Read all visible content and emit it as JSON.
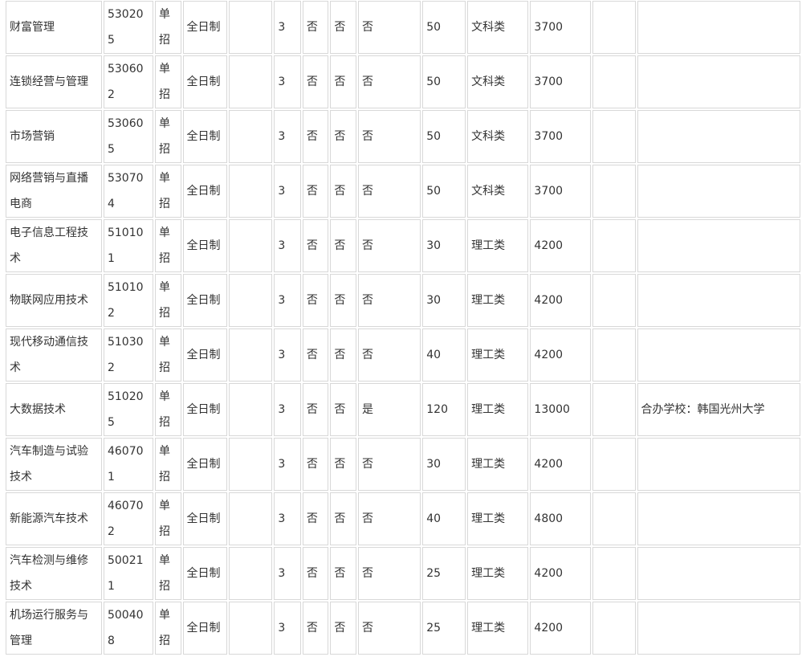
{
  "table": {
    "rows": [
      {
        "major": "财富管理",
        "code": "530205",
        "type": "单招",
        "mode": "全日制",
        "blank1": "",
        "years": "3",
        "f1": "否",
        "f2": "否",
        "f3": "否",
        "plan": "50",
        "category": "文科类",
        "fee": "3700",
        "blank2": "",
        "note": ""
      },
      {
        "major": "连锁经营与管理",
        "code": "530602",
        "type": "单招",
        "mode": "全日制",
        "blank1": "",
        "years": "3",
        "f1": "否",
        "f2": "否",
        "f3": "否",
        "plan": "50",
        "category": "文科类",
        "fee": "3700",
        "blank2": "",
        "note": ""
      },
      {
        "major": "市场营销",
        "code": "530605",
        "type": "单招",
        "mode": "全日制",
        "blank1": "",
        "years": "3",
        "f1": "否",
        "f2": "否",
        "f3": "否",
        "plan": "50",
        "category": "文科类",
        "fee": "3700",
        "blank2": "",
        "note": ""
      },
      {
        "major": "网络营销与直播电商",
        "code": "530704",
        "type": "单招",
        "mode": "全日制",
        "blank1": "",
        "years": "3",
        "f1": "否",
        "f2": "否",
        "f3": "否",
        "plan": "50",
        "category": "文科类",
        "fee": "3700",
        "blank2": "",
        "note": ""
      },
      {
        "major": "电子信息工程技术",
        "code": "510101",
        "type": "单招",
        "mode": "全日制",
        "blank1": "",
        "years": "3",
        "f1": "否",
        "f2": "否",
        "f3": "否",
        "plan": "30",
        "category": "理工类",
        "fee": "4200",
        "blank2": "",
        "note": ""
      },
      {
        "major": "物联网应用技术",
        "code": "510102",
        "type": "单招",
        "mode": "全日制",
        "blank1": "",
        "years": "3",
        "f1": "否",
        "f2": "否",
        "f3": "否",
        "plan": "30",
        "category": "理工类",
        "fee": "4200",
        "blank2": "",
        "note": ""
      },
      {
        "major": "现代移动通信技术",
        "code": "510302",
        "type": "单招",
        "mode": "全日制",
        "blank1": "",
        "years": "3",
        "f1": "否",
        "f2": "否",
        "f3": "否",
        "plan": "40",
        "category": "理工类",
        "fee": "4200",
        "blank2": "",
        "note": ""
      },
      {
        "major": "大数据技术",
        "code": "510205",
        "type": "单招",
        "mode": "全日制",
        "blank1": "",
        "years": "3",
        "f1": "否",
        "f2": "否",
        "f3": "是",
        "plan": "120",
        "category": "理工类",
        "fee": "13000",
        "blank2": "",
        "note": "合办学校：韩国光州大学"
      },
      {
        "major": "汽车制造与试验技术",
        "code": "460701",
        "type": "单招",
        "mode": "全日制",
        "blank1": "",
        "years": "3",
        "f1": "否",
        "f2": "否",
        "f3": "否",
        "plan": "30",
        "category": "理工类",
        "fee": "4200",
        "blank2": "",
        "note": ""
      },
      {
        "major": "新能源汽车技术",
        "code": "460702",
        "type": "单招",
        "mode": "全日制",
        "blank1": "",
        "years": "3",
        "f1": "否",
        "f2": "否",
        "f3": "否",
        "plan": "40",
        "category": "理工类",
        "fee": "4800",
        "blank2": "",
        "note": ""
      },
      {
        "major": "汽车检测与维修技术",
        "code": "500211",
        "type": "单招",
        "mode": "全日制",
        "blank1": "",
        "years": "3",
        "f1": "否",
        "f2": "否",
        "f3": "否",
        "plan": "25",
        "category": "理工类",
        "fee": "4200",
        "blank2": "",
        "note": ""
      },
      {
        "major": "机场运行服务与管理",
        "code": "500408",
        "type": "单招",
        "mode": "全日制",
        "blank1": "",
        "years": "3",
        "f1": "否",
        "f2": "否",
        "f3": "否",
        "plan": "25",
        "category": "理工类",
        "fee": "4200",
        "blank2": "",
        "note": ""
      }
    ]
  }
}
